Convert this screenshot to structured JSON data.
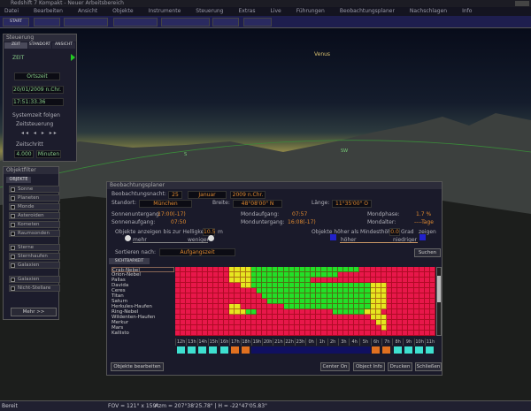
{
  "app": {
    "title": "Redshift 7 Kompakt - Neuer Arbeitsbereich"
  },
  "menu": [
    "Datei",
    "Bearbeiten",
    "Ansicht",
    "Objekte",
    "Instrumente",
    "Steuerung",
    "Extras",
    "Live",
    "Führungen",
    "Beobachtungsplaner",
    "Nachschlagen",
    "Info"
  ],
  "toolbar": {
    "start": "START"
  },
  "sky": {
    "venus": "Venus",
    "sw": "SW",
    "s": "S"
  },
  "steuerung": {
    "title": "Steuerung",
    "tabs": [
      "ZEIT",
      "STANDORT",
      "ANSICHT"
    ],
    "mode": "ZEIT",
    "zone": "Ortszeit",
    "date": "20/01/2009 n.Chr.",
    "time": "17:51:33.36",
    "systemzeit": "Systemzeit folgen",
    "zeitsteuerung": "Zeitsteuerung",
    "zeitschritt": "Zeitschritt",
    "step": "4.000",
    "unit": "Minuten"
  },
  "objektfilter": {
    "title": "Objektfilter",
    "tab": "OBJEKTE",
    "items": [
      "Sonne",
      "Planeten",
      "Monde",
      "Asteroiden",
      "Kometen",
      "Raumsonden",
      "Sterne",
      "Sternhaufen",
      "Galaxien",
      "Galaxien",
      "Nicht-Stellare"
    ],
    "more": "Mehr >>"
  },
  "planer": {
    "title": "Beobachtungsplaner",
    "nacht_label": "Beobachtungsnacht:",
    "day": "25",
    "month": "Januar",
    "year": "2009  n.Chr.",
    "standort_label": "Standort:",
    "standort": "München",
    "breite_label": "Breite:",
    "breite": "48°08'00\" N",
    "laenge_label": "Länge:",
    "laenge": "11°35'00\" O",
    "su_label": "Sonnenuntergang:",
    "su": "17:00(-17)",
    "sa_label": "Sonnenaufgang:",
    "sa": "07:50",
    "ma_label": "Mondaufgang:",
    "ma": "07:57",
    "mu_label": "Monduntergang:",
    "mu": "16:08(-17)",
    "mp_label": "Mondphase:",
    "mp": "1.7 %",
    "mal_label": "Mondalter:",
    "mal": "----Tage",
    "hell_label": "Objekte anzeigen bis zur Helligkeit",
    "hell": "10.5",
    "hell_unit": "m",
    "mehr": "mehr",
    "weniger": "weniger",
    "hoehe_label": "Objekte höher als Mindesthöhe",
    "hoehe": "0.0",
    "hoehe_unit": "Grad",
    "hoehe_suffix": "zeigen",
    "hoeher": "höher",
    "niedriger": "niedriger",
    "sort_label": "Sortieren nach:",
    "sort": "Aufgangszeit",
    "search": "Suchen",
    "tab": "SICHTBARKEIT",
    "objects": [
      "Crab-Nebel",
      "Orion-Nebel",
      "Pallas",
      "Davida",
      "Ceres",
      "Titan",
      "Saturn",
      "Herkules-Haufen",
      "Ring-Nebel",
      "Wildenten-Haufen",
      "Merkur",
      "Mars",
      "Kallisto"
    ],
    "visibility": [
      "rrrrrrrrrryyyyggggggggggggggggggggrrrrrrrrrrrrrrr",
      "rrrrrrrrrryyyyggggggggggggggggrrrrrrrrrrrrrrrrrrr",
      "rrrrrrrrrryyyygggggggggggrrrrrrrrrrrrrrrrrrrrrrrr",
      "rrrrrrrrrrrryyggggggggggggggggggggggyyyrrrrrrrrrrr",
      "rrrrrrrrrrrrrrrgggggggggggggggggggggyyyrrrrrrrrrr",
      "rrrrrrrrrrrrrrrrggggggggggggggggggggyyyrrrrrrrrrr",
      "rrrrrrrrrrrrrrrrrgggggggggggggggggggyyyrrrrrrrrrr",
      "rrrrrrrrrryyrrrrrrrrggggggggggggggggyyyrrrrrrrrrr",
      "rrrrrrrrrryyyggrrrrrrrrrrrrrrggggggyyyrrrrrrrrrrr",
      "rrrrrrrrrrrrrrrrrrrrrrrrrrrrrrrrrrrryyyrrrrrrrrrr",
      "rrrrrrrrrrrrrrrrrrrrrrrrrrrrrrrrrrrrryyrrrrrrrrrr",
      "rrrrrrrrrrrrrrrrrrrrrrrrrrrrrrrrrrrrrryrrrrrrrrrr",
      "rrrrrrrrrrrrrrrrrrrrrrrrrrrrrrrrrrrrrrrrrrrrrrrr"
    ],
    "hours": [
      "12h",
      "13h",
      "14h",
      "15h",
      "16h",
      "17h",
      "18h",
      "19h",
      "20h",
      "21h",
      "22h",
      "23h",
      "0h",
      "1h",
      "2h",
      "3h",
      "4h",
      "5h",
      "6h",
      "7h",
      "8h",
      "9h",
      "10h",
      "11h"
    ],
    "sky_states": [
      "day",
      "day",
      "day",
      "day",
      "day",
      "twilight",
      "twilight",
      "night",
      "night",
      "night",
      "night",
      "night",
      "night",
      "night",
      "night",
      "night",
      "night",
      "night",
      "twilight",
      "twilight",
      "day",
      "day",
      "day",
      "day"
    ],
    "buttons": {
      "edit": "Objekte bearbeiten",
      "center": "Center On",
      "info": "Object Info",
      "print": "Drucken",
      "close": "Schließen"
    },
    "colors": {
      "r": "#e8174a",
      "y": "#e6e620",
      "g": "#22e028",
      "day": "#3ee0d0",
      "twilight": "#e07020",
      "night": "#101060"
    }
  },
  "status": {
    "mode": "Bereit",
    "fov": "FOV = 121° x 159°",
    "pos": "Azm = 207°38'25.78\" | H = -22°47'05.83\""
  }
}
